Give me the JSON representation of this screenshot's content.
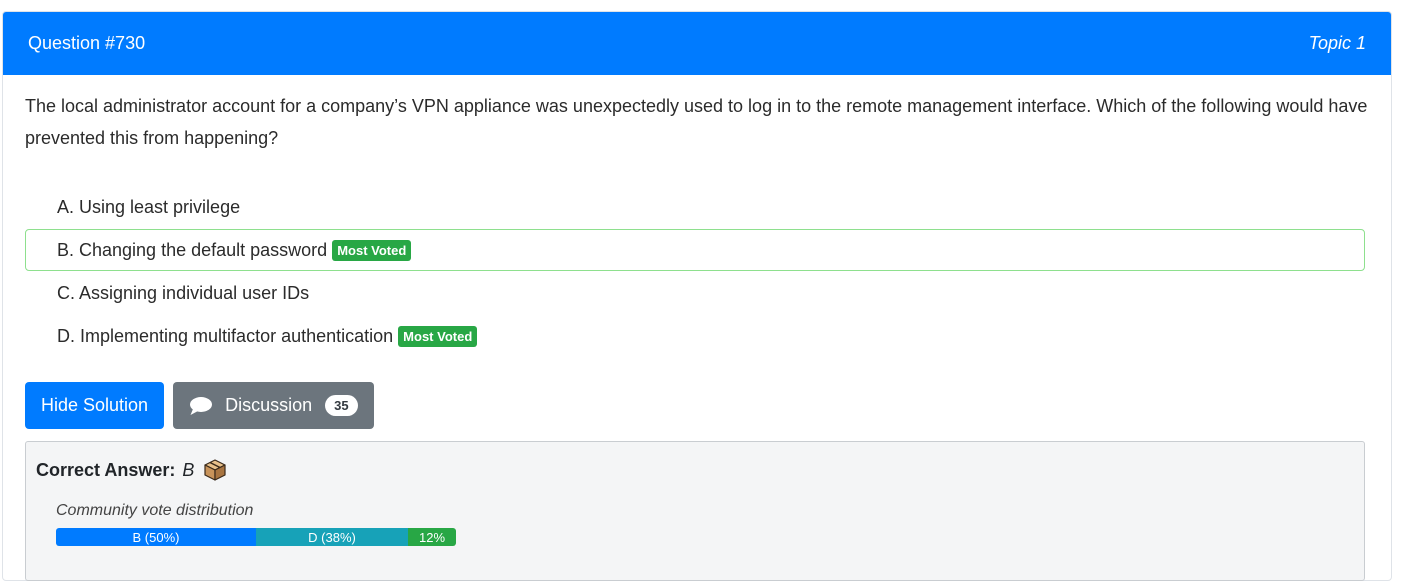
{
  "header": {
    "question_number": "Question #730",
    "topic": "Topic 1"
  },
  "question": {
    "text": "The local administrator account for a company’s VPN appliance was unexpectedly used to log in to the remote management interface. Which of the following would have prevented this from happening?"
  },
  "choices": [
    {
      "text": "A. Using least privilege",
      "badge": ""
    },
    {
      "text": "B. Changing the default password",
      "badge": "Most Voted"
    },
    {
      "text": "C. Assigning individual user IDs",
      "badge": ""
    },
    {
      "text": "D. Implementing multifactor authentication",
      "badge": "Most Voted"
    }
  ],
  "buttons": {
    "hide_solution": "Hide Solution",
    "discussion": "Discussion",
    "discussion_count": "35"
  },
  "answer": {
    "label": "Correct Answer:",
    "value": "B",
    "icon": "ballot-box-icon"
  },
  "votes": {
    "title": "Community vote distribution",
    "segments": [
      {
        "label": "B (50%)",
        "percent": 50,
        "color": "#007bff"
      },
      {
        "label": "D (38%)",
        "percent": 38,
        "color": "#17a2b8"
      },
      {
        "label": "12%",
        "percent": 12,
        "color": "#28a745"
      }
    ]
  },
  "colors": {
    "primary": "#007bff",
    "secondary": "#6c757d",
    "success": "#28a745",
    "info": "#17a2b8"
  }
}
